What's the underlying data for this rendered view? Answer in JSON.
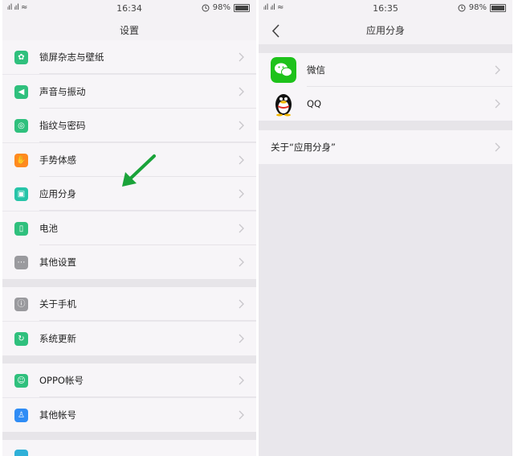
{
  "left": {
    "status": {
      "signal": "ᵢıl ᵢıl ≈",
      "time": "16:34",
      "alarm_icon": "clock-icon",
      "battery": "98%"
    },
    "title": "设置",
    "group1": [
      {
        "label": "锁屏杂志与壁纸",
        "icon": "flower-icon",
        "color": "#2fc07d"
      },
      {
        "label": "声音与振动",
        "icon": "speaker-icon",
        "color": "#2fc07d"
      },
      {
        "label": "指纹与密码",
        "icon": "fingerprint-icon",
        "color": "#2fc07d"
      },
      {
        "label": "手势体感",
        "icon": "hand-icon",
        "color": "#ff8a1f"
      },
      {
        "label": "应用分身",
        "icon": "app-clone-icon",
        "color": "#27c4a8"
      },
      {
        "label": "电池",
        "icon": "battery-icon",
        "color": "#2fc07d"
      },
      {
        "label": "其他设置",
        "icon": "more-icon",
        "color": "#9a9a9e"
      }
    ],
    "group2": [
      {
        "label": "关于手机",
        "icon": "info-icon",
        "color": "#9a9a9e"
      },
      {
        "label": "系统更新",
        "icon": "update-icon",
        "color": "#2fc07d"
      }
    ],
    "group3": [
      {
        "label": "OPPO帐号",
        "icon": "person-icon",
        "color": "#2fc07d"
      },
      {
        "label": "其他帐号",
        "icon": "account-icon",
        "color": "#2f8cf5"
      }
    ],
    "arrow_color": "#1aa33a"
  },
  "right": {
    "status": {
      "signal": "ᵢıl ᵢıl ≈",
      "time": "16:35",
      "alarm_icon": "clock-icon",
      "battery": "98%"
    },
    "title": "应用分身",
    "apps": [
      {
        "label": "微信",
        "icon": "wechat-icon",
        "color": "#1ec21b"
      },
      {
        "label": "QQ",
        "icon": "qq-penguin-icon",
        "color": "#000000"
      }
    ],
    "about": "关于“应用分身”"
  }
}
